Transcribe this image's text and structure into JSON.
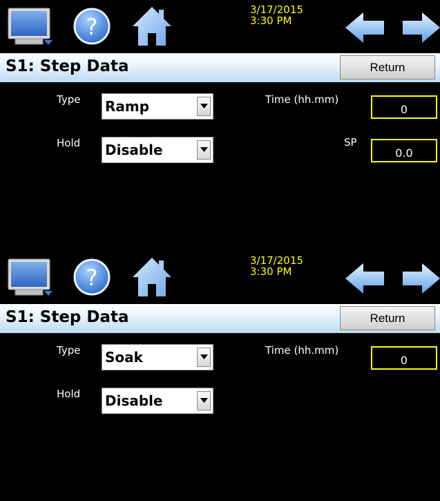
{
  "screens": [
    {
      "datetime": {
        "date": "3/17/2015",
        "time": "3:30 PM"
      },
      "title": "S1: Step Data",
      "return_label": "Return",
      "type": {
        "label": "Type",
        "value": "Ramp"
      },
      "hold": {
        "label": "Hold",
        "value": "Disable"
      },
      "time": {
        "label": "Time (hh.mm)",
        "value": "0"
      },
      "sp": {
        "label": "SP",
        "value": "0.0"
      }
    },
    {
      "datetime": {
        "date": "3/17/2015",
        "time": "3:30 PM"
      },
      "title": "S1: Step Data",
      "return_label": "Return",
      "type": {
        "label": "Type",
        "value": "Soak"
      },
      "hold": {
        "label": "Hold",
        "value": "Disable"
      },
      "time": {
        "label": "Time (hh.mm)",
        "value": "0"
      }
    }
  ],
  "icons": {
    "monitor": "monitor-icon",
    "help": "help-icon",
    "home": "home-icon",
    "back": "back-arrow-icon",
    "forward": "forward-arrow-icon"
  },
  "colors": {
    "background": "#000000",
    "datetime": "#ffff00",
    "field_border": "#ffff00",
    "title_gradient_top": "#ffffff",
    "title_gradient_bottom": "#b9dcf2",
    "icon_blue": "#2f78d8"
  }
}
